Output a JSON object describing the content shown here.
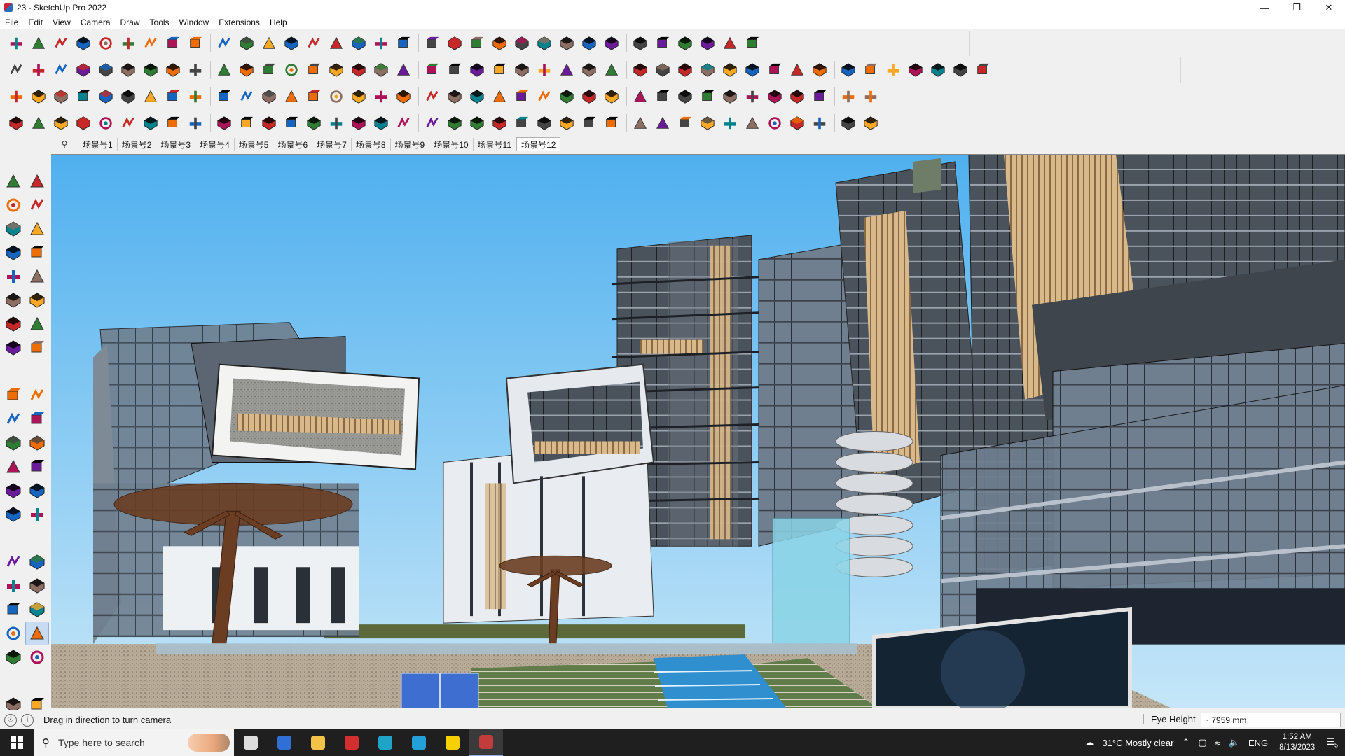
{
  "window": {
    "title": "23 - SketchUp Pro 2022",
    "controls": [
      "minimize",
      "restore",
      "close"
    ]
  },
  "menu": [
    "File",
    "Edit",
    "View",
    "Camera",
    "Draw",
    "Tools",
    "Window",
    "Extensions",
    "Help"
  ],
  "toolbars": {
    "row1": [
      "zoom-icon",
      "select-icon",
      "eraser-icon",
      "pencil-icon",
      "lasso-icon",
      "paint-icon",
      "pushpull-icon",
      "followme-icon",
      "move-icon",
      "rotate-icon",
      "scale-icon",
      "tape-icon",
      "text-icon",
      "paintbucket-icon",
      "orbit-icon",
      "pan-icon",
      "zoom-icon",
      "zoom-extents-icon",
      "section-icon",
      "layers-icon",
      "styles-icon",
      "tags-icon",
      "user-icon",
      "component-icon",
      "select-component-icon",
      "axes-icon",
      "up-arrows-icon",
      "down-arrows-icon",
      "dimension-icon",
      "xray-icon",
      "undo-icon",
      "redo-icon",
      "ruby-icon"
    ],
    "row2": [
      "iso-view-icon",
      "top-view-icon",
      "front-view-icon",
      "push-red-icon",
      "push-blue-icon",
      "push-red2-icon",
      "push-green-icon",
      "push-orange-icon",
      "push-orange2-icon",
      "push-magenta-icon",
      "soften-icon",
      "wall-icon",
      "wall2-icon",
      "wall3-icon",
      "roof-icon",
      "roof2-icon",
      "house-icon",
      "house2-icon",
      "home-icon",
      "home2-icon",
      "shelf-icon",
      "fx-icon",
      "sketch-icon",
      "pen-icon",
      "rect-icon",
      "circle-icon",
      "hexagon-icon",
      "ellipse-icon",
      "parallelogram-icon",
      "arc-icon",
      "ring-icon",
      "polygon-icon",
      "spiral-icon",
      "line-tool-icon",
      "curve-tool-icon",
      "box-icon",
      "cube-icon",
      "brick-icon",
      "grid-icon",
      "terrain-icon",
      "boulder-icon",
      "globe-icon",
      "plate-icon"
    ],
    "row3": [
      "face-blue-icon",
      "face-blue2-icon",
      "face-yellow-icon",
      "face-green-icon",
      "face-red-icon",
      "face-white-icon",
      "loop-icon",
      "square-red-icon",
      "stack-icon",
      "curve-face-icon",
      "block-icon",
      "pipe-icon",
      "bend-icon",
      "node-line-icon",
      "cross-red-icon",
      "cross-green-icon",
      "cross-blue-icon",
      "cone-icon",
      "lamp-icon",
      "triangle-icon",
      "hook-icon",
      "hook2-icon",
      "hook3-icon",
      "move4-icon",
      "box-brown-icon",
      "magnet-icon",
      "tree-icon",
      "boxes-icon",
      "boxes2-icon",
      "cube-red-icon",
      "cluster-icon",
      "pavilion-icon",
      "grid-orange-icon",
      "grid-orange2-icon",
      "grid-orange3-icon",
      "dots-icon",
      "dotted-curve-icon",
      "qr-icon"
    ],
    "row4": [
      "polyline-icon",
      "curve-dots-icon",
      "car-icon",
      "scissor-icon",
      "gear-icon",
      "plane-icon",
      "spring-icon",
      "mesh-icon",
      "sphere-icon",
      "chair-icon",
      "stairs-icon",
      "stairs2-icon",
      "stairs3-icon",
      "stairs4-icon",
      "bridge-icon",
      "comb-icon",
      "comb2-icon",
      "hand-icon",
      "leaf-icon",
      "wedge-icon",
      "ribbon-icon",
      "ramp-icon",
      "fan-icon",
      "fan2-icon",
      "fan3-icon",
      "truss-icon",
      "truss2-icon",
      "panel-icon",
      "panel2-icon",
      "panel3-icon",
      "panel4-icon",
      "panel5-icon",
      "panel6-icon",
      "panel7-icon",
      "panel8-icon",
      "panel9-icon",
      "panel10-icon",
      "panel11-icon"
    ]
  },
  "left_toolbar": [
    [
      "select-icon",
      "orbit-icon"
    ],
    [
      "paint-bucket-icon",
      "eraser-icon"
    ],
    [
      "component-icon",
      "tape-icon"
    ],
    [
      "pencil-icon",
      "freehand-icon"
    ],
    [
      "rectangle-icon",
      "rotated-rect-icon"
    ],
    [
      "circle-icon",
      "polygon-icon"
    ],
    [
      "arc-icon",
      "arc2-icon"
    ],
    [
      "pie-icon",
      "arc3-icon"
    ],
    [
      "move-icon",
      "pushpull-icon"
    ],
    [
      "rotate-icon",
      "followme-icon"
    ],
    [
      "scale-icon",
      "offset-icon"
    ],
    [
      "tape-measure-icon",
      "dimension-icon"
    ],
    [
      "protractor-icon",
      "text-icon"
    ],
    [
      "axes-icon",
      "3d-text-icon"
    ],
    [
      "orbit2-icon",
      "pan-icon"
    ],
    [
      "zoom-icon",
      "zoom-window-icon"
    ],
    [
      "zoom-extents-icon",
      "previous-view-icon"
    ],
    [
      "walk-icon",
      "look-around-icon"
    ],
    [
      "footprints-icon",
      "position-camera-icon"
    ],
    [
      "section-plane-icon",
      "section-display-icon"
    ],
    [
      "section-cut-icon",
      "section-fill-icon"
    ]
  ],
  "left_toolbar_active": "look-around-icon",
  "scenes": {
    "tabs": [
      "场景号1",
      "场景号2",
      "场景号3",
      "场景号4",
      "场景号5",
      "场景号6",
      "场景号7",
      "场景号8",
      "场景号9",
      "场景号10",
      "场景号11",
      "场景号12"
    ],
    "active": "场景号12"
  },
  "status": {
    "message": "Drag in direction to turn camera",
    "vcb_label": "Eye Height",
    "vcb_value": "~ 7959 mm"
  },
  "taskbar": {
    "search_placeholder": "Type here to search",
    "apps": [
      "task-view-icon",
      "calculator-icon",
      "file-explorer-icon",
      "acrobat-icon",
      "3d-app-icon",
      "edge-icon",
      "sticky-notes-icon",
      "sketchup-icon"
    ],
    "weather": "31°C  Mostly clear",
    "language": "ENG",
    "time": "1:52 AM",
    "date": "8/13/2023",
    "notifications": "5"
  },
  "colors": {
    "sky_top": "#55b4f0",
    "sky_bottom": "#bfe3f7",
    "accent": "#8bb2de"
  }
}
